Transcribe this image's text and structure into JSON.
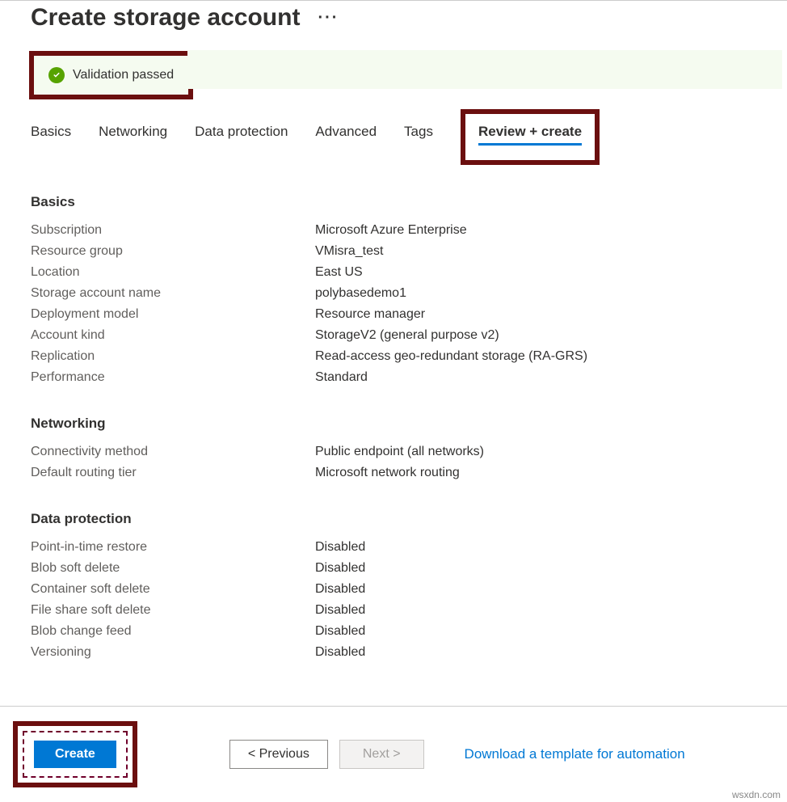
{
  "header": {
    "title": "Create storage account",
    "ellipsis": "···"
  },
  "validation": {
    "text": "Validation passed"
  },
  "tabs": {
    "basics": "Basics",
    "networking": "Networking",
    "data_protection": "Data protection",
    "advanced": "Advanced",
    "tags": "Tags",
    "review_create": "Review + create"
  },
  "sections": {
    "basics": {
      "title": "Basics",
      "rows": {
        "subscription": {
          "label": "Subscription",
          "value": "Microsoft Azure Enterprise"
        },
        "resource_group": {
          "label": "Resource group",
          "value": "VMisra_test"
        },
        "location": {
          "label": "Location",
          "value": "East US"
        },
        "storage_account_name": {
          "label": "Storage account name",
          "value": "polybasedemo1"
        },
        "deployment_model": {
          "label": "Deployment model",
          "value": "Resource manager"
        },
        "account_kind": {
          "label": "Account kind",
          "value": "StorageV2 (general purpose v2)"
        },
        "replication": {
          "label": "Replication",
          "value": "Read-access geo-redundant storage (RA-GRS)"
        },
        "performance": {
          "label": "Performance",
          "value": "Standard"
        }
      }
    },
    "networking": {
      "title": "Networking",
      "rows": {
        "connectivity_method": {
          "label": "Connectivity method",
          "value": "Public endpoint (all networks)"
        },
        "default_routing_tier": {
          "label": "Default routing tier",
          "value": "Microsoft network routing"
        }
      }
    },
    "data_protection": {
      "title": "Data protection",
      "rows": {
        "point_in_time_restore": {
          "label": "Point-in-time restore",
          "value": "Disabled"
        },
        "blob_soft_delete": {
          "label": "Blob soft delete",
          "value": "Disabled"
        },
        "container_soft_delete": {
          "label": "Container soft delete",
          "value": "Disabled"
        },
        "file_share_soft_delete": {
          "label": "File share soft delete",
          "value": "Disabled"
        },
        "blob_change_feed": {
          "label": "Blob change feed",
          "value": "Disabled"
        },
        "versioning": {
          "label": "Versioning",
          "value": "Disabled"
        }
      }
    }
  },
  "footer": {
    "create": "Create",
    "previous": "<  Previous",
    "next": "Next  >",
    "download_link": "Download a template for automation"
  },
  "watermark": "wsxdn.com"
}
